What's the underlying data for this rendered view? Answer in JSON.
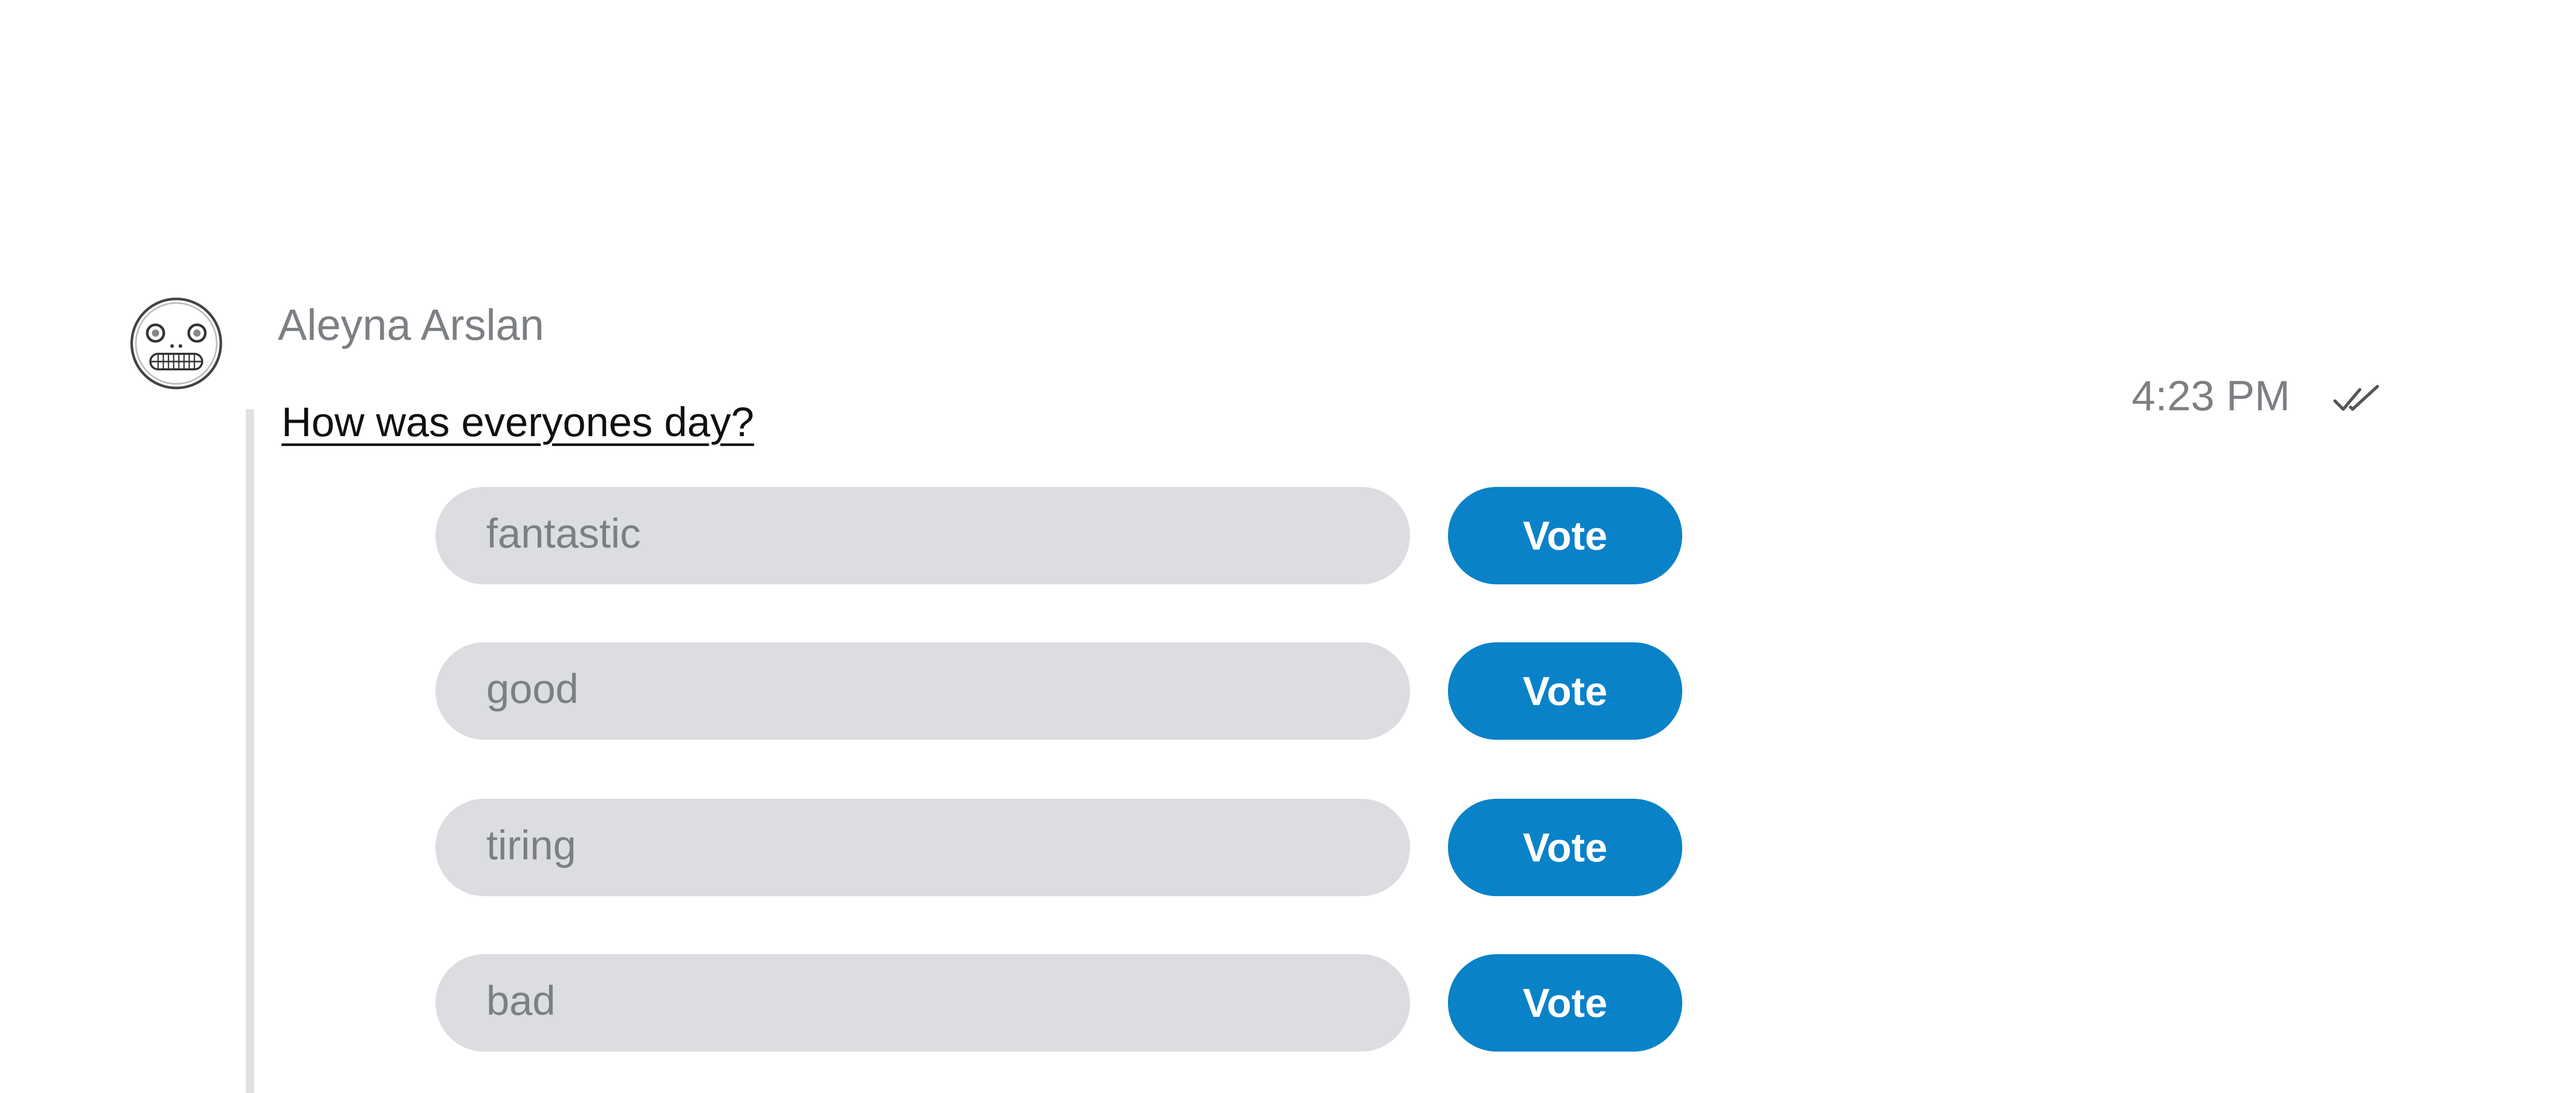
{
  "message": {
    "sender": "Aleyna Arslan",
    "time": "4:23 PM",
    "question": "How was everyones day?",
    "read_status_icon": "double-check-icon",
    "avatar_icon": "grinning-face-avatar-icon"
  },
  "poll": {
    "options": [
      {
        "label": "fantastic",
        "button": "Vote"
      },
      {
        "label": "good",
        "button": "Vote"
      },
      {
        "label": "tiring",
        "button": "Vote"
      },
      {
        "label": "bad",
        "button": "Vote"
      }
    ]
  },
  "colors": {
    "accent": "#0a82c8",
    "pill_background": "#dcdde0",
    "muted_text": "#7c7f84",
    "thread_bar": "#dfe0e2"
  }
}
